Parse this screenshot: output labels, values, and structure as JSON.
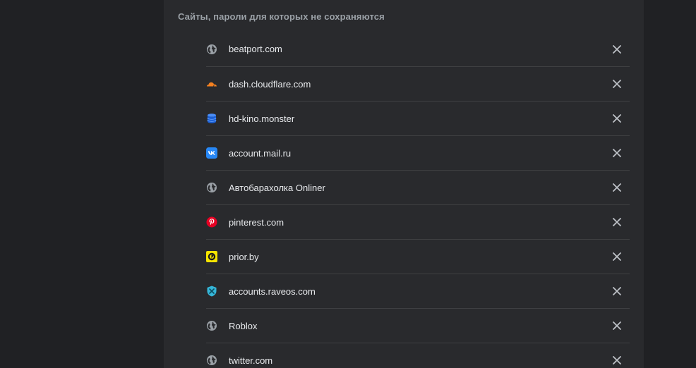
{
  "section": {
    "title": "Сайты, пароли для которых не сохраняются"
  },
  "sites": [
    {
      "label": "beatport.com",
      "icon": "globe-icon"
    },
    {
      "label": "dash.cloudflare.com",
      "icon": "cloudflare-icon"
    },
    {
      "label": "hd-kino.monster",
      "icon": "database-icon"
    },
    {
      "label": "account.mail.ru",
      "icon": "vk-icon"
    },
    {
      "label": "Автобарахолка Onliner",
      "icon": "globe-icon"
    },
    {
      "label": "pinterest.com",
      "icon": "pinterest-icon"
    },
    {
      "label": "prior.by",
      "icon": "prior-icon"
    },
    {
      "label": "accounts.raveos.com",
      "icon": "raveos-icon"
    },
    {
      "label": "Roblox",
      "icon": "globe-icon"
    },
    {
      "label": "twitter.com",
      "icon": "globe-icon"
    }
  ],
  "remove_icon": "close-icon",
  "colors": {
    "page_bg": "#202124",
    "card_bg": "#292a2d",
    "divider": "#3f4042",
    "title_text": "#9aa0a6",
    "row_text": "#e8eaed",
    "icon_gray": "#9aa0a6"
  }
}
